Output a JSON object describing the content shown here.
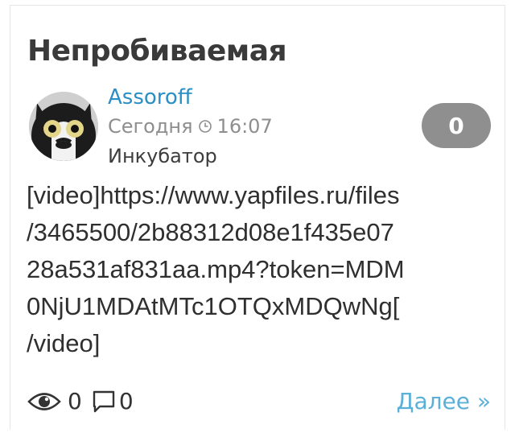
{
  "post": {
    "title": "Непробиваемая",
    "author": "Assoroff",
    "date": "Сегодня",
    "time": "16:07",
    "category": "Инкубатор",
    "rating": "0",
    "body_lines": [
      "[video]https://www.yapfiles.ru/files",
      "/3465500/2b88312d08e1f435e07",
      "28a531af831aa.mp4?token=MDM",
      "0NjU1MDAtMTc1OTQxMDQwNg[",
      "/video]"
    ],
    "views": "0",
    "comments": "0",
    "more_label": "Далее »"
  },
  "icons": {
    "avatar": "cat-avatar",
    "clock": "clock-icon",
    "views": "eye-icon",
    "comments": "comment-bubble-icon"
  },
  "colors": {
    "author_link": "#2a8fc4",
    "more_link": "#5bb0d8",
    "rating_badge": "#8f8f8f",
    "meta_text": "#8e8e8e"
  }
}
